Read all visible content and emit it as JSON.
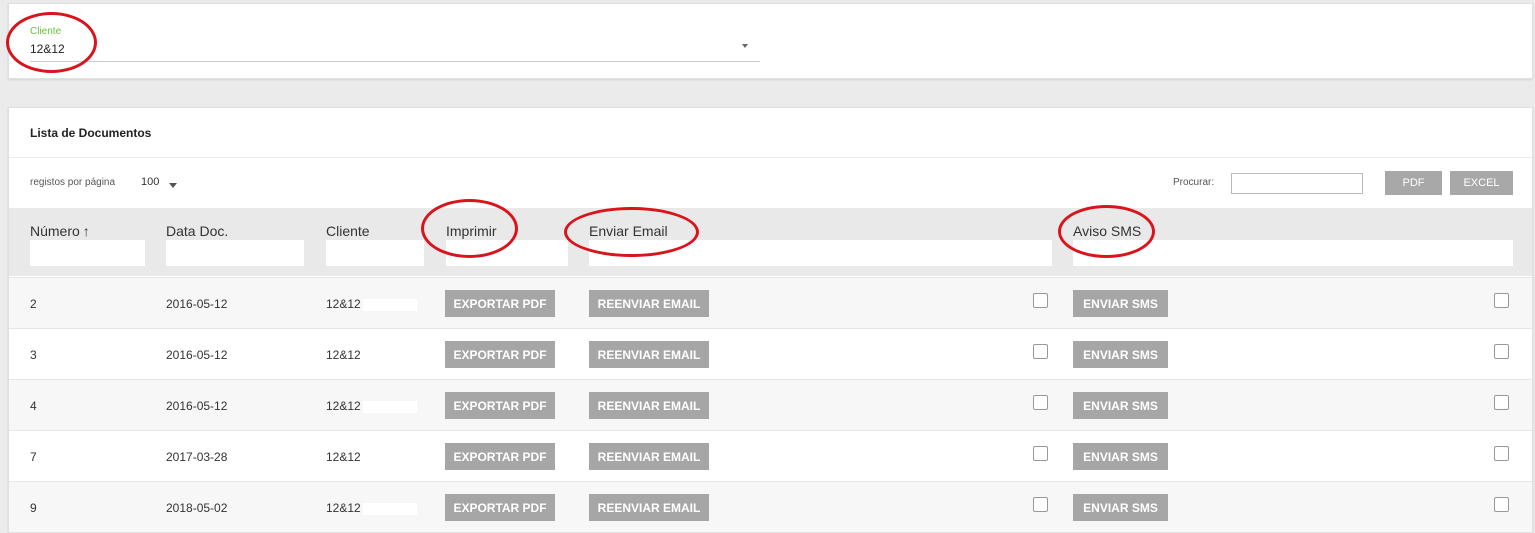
{
  "client": {
    "label": "Cliente",
    "value": "12&12"
  },
  "docs": {
    "title": "Lista de Documentos",
    "page_size_label": "registos por página",
    "page_size": "100",
    "search_label": "Procurar:",
    "search_value": "",
    "pdf_button": "PDF",
    "excel_button": "EXCEL",
    "columns": {
      "numero": "Número",
      "data": "Data Doc.",
      "cliente": "Cliente",
      "imprimir": "Imprimir",
      "email": "Enviar Email",
      "sms": "Aviso SMS"
    },
    "rows": [
      {
        "numero": "2",
        "data": "2016-05-12",
        "cliente": "12&12"
      },
      {
        "numero": "3",
        "data": "2016-05-12",
        "cliente": "12&12"
      },
      {
        "numero": "4",
        "data": "2016-05-12",
        "cliente": "12&12"
      },
      {
        "numero": "7",
        "data": "2017-03-28",
        "cliente": "12&12"
      },
      {
        "numero": "9",
        "data": "2018-05-02",
        "cliente": "12&12"
      }
    ],
    "row_actions": {
      "export_pdf": "EXPORTAR PDF",
      "resend_email": "REENVIAR EMAIL",
      "send_sms": "ENVIAR SMS"
    }
  },
  "colors": {
    "accent_label": "#6cbf3a",
    "button_gray": "#a6a6a6",
    "annotation_red": "#d9141b"
  }
}
